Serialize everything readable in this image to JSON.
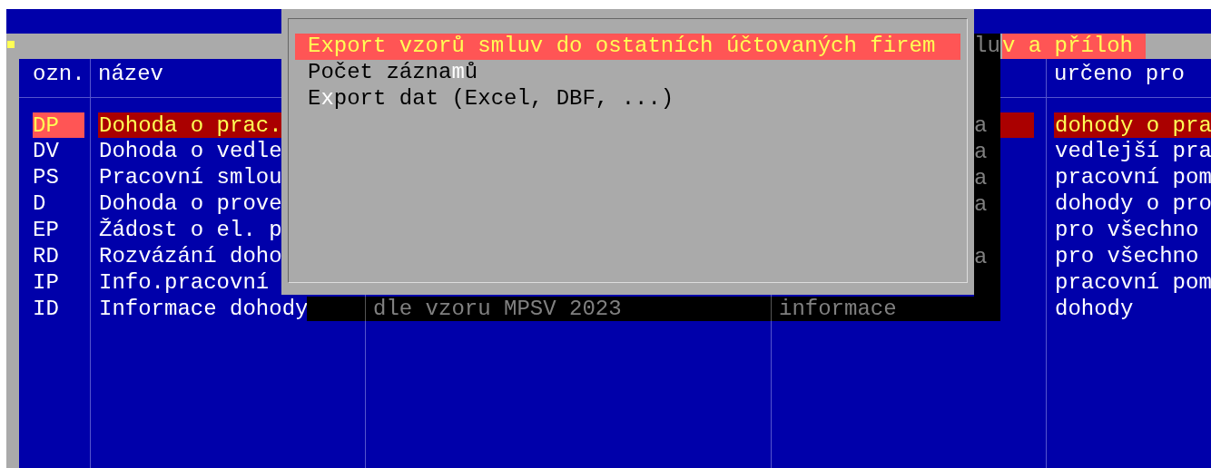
{
  "window": {
    "title_shadowed": "lu",
    "title": "v a příloh"
  },
  "table": {
    "columns": [
      "ozn.",
      "název",
      null,
      null,
      "určeno pro"
    ],
    "rows": [
      {
        "code": "DP",
        "name": "Dohoda o prac.",
        "column_4": "a",
        "column_5": "dohody o pra",
        "selected": true
      },
      {
        "code": "DV",
        "name": "Dohoda o vedle",
        "column_4": "a",
        "column_5": "vedlejší pra",
        "selected": false
      },
      {
        "code": "PS",
        "name": "Pracovní smlou",
        "column_4": "a",
        "column_5": "pracovní pom",
        "selected": false
      },
      {
        "code": "D",
        "name": "Dohoda o prove",
        "column_4": "a",
        "column_5": "dohody o pro",
        "selected": false
      },
      {
        "code": "EP",
        "name": "Žádost o el. p",
        "column_5": "pro všechno",
        "selected": false
      },
      {
        "code": "RD",
        "name": "Rozvázání doho",
        "column_4": "a",
        "column_5": "pro všechno",
        "selected": false
      },
      {
        "code": "IP",
        "name": "Info.pracovní",
        "column_5": "pracovní pom",
        "selected": false
      },
      {
        "code": "ID",
        "name": "Informace dohody",
        "column_3": "dle vzoru MPSV 2023",
        "column_4": "informace",
        "column_5": "dohody",
        "selected": false
      }
    ]
  },
  "popup_menu": {
    "items": [
      {
        "before": "Export vzorů smluv do ostatních účtovaných firem",
        "selected": true
      },
      {
        "before": "Počet zázna",
        "hotkey": "m",
        "after": "ů",
        "selected": false
      },
      {
        "before": "E",
        "hotkey": "x",
        "after": "port dat (Excel, DBF, ...)",
        "selected": false
      }
    ]
  }
}
